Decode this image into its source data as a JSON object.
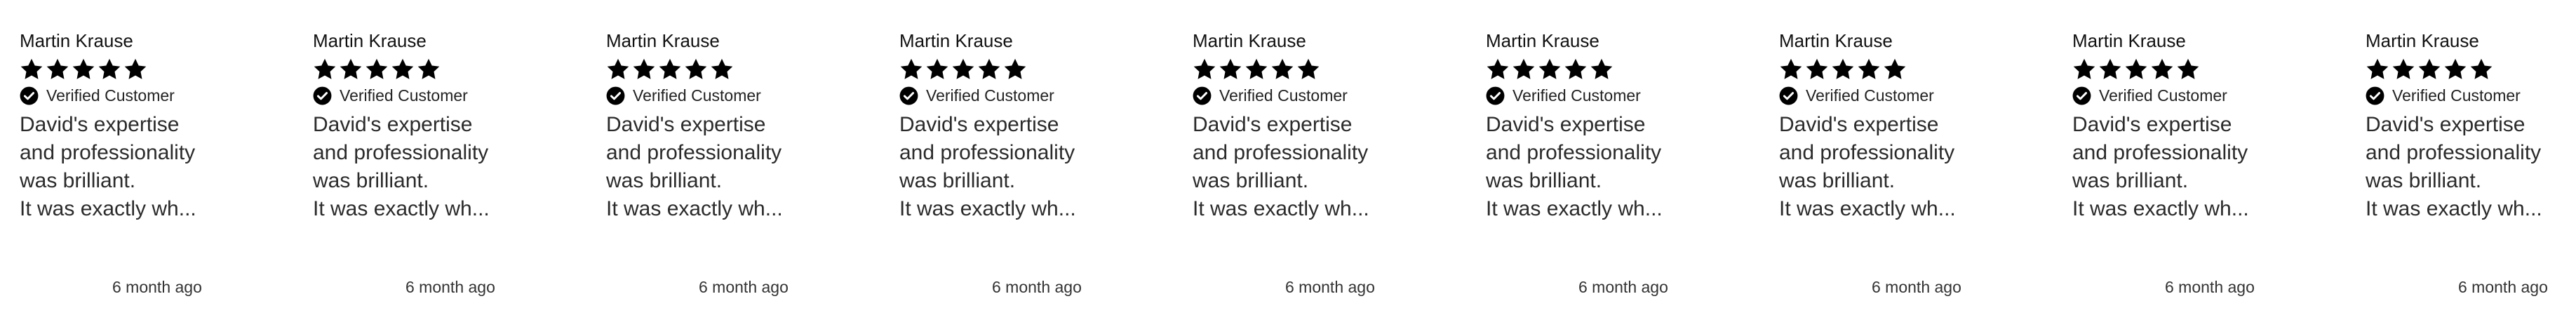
{
  "reviews": [
    {
      "name": "Martin Krause",
      "rating": 5,
      "verified_label": "Verified Customer",
      "text_lines": [
        "David's expertise",
        "and professionality",
        "was brilliant.",
        "It was exactly wh..."
      ],
      "date": "6 month ago"
    },
    {
      "name": "Martin Krause",
      "rating": 5,
      "verified_label": "Verified Customer",
      "text_lines": [
        "David's expertise",
        "and professionality",
        "was brilliant.",
        "It was exactly wh..."
      ],
      "date": "6 month ago"
    },
    {
      "name": "Martin Krause",
      "rating": 5,
      "verified_label": "Verified Customer",
      "text_lines": [
        "David's expertise",
        "and professionality",
        "was brilliant.",
        "It was exactly wh..."
      ],
      "date": "6 month ago"
    },
    {
      "name": "Martin Krause",
      "rating": 5,
      "verified_label": "Verified Customer",
      "text_lines": [
        "David's expertise",
        "and professionality",
        "was brilliant.",
        "It was exactly wh..."
      ],
      "date": "6 month ago"
    },
    {
      "name": "Martin Krause",
      "rating": 5,
      "verified_label": "Verified Customer",
      "text_lines": [
        "David's expertise",
        "and professionality",
        "was brilliant.",
        "It was exactly wh..."
      ],
      "date": "6 month ago"
    },
    {
      "name": "Martin Krause",
      "rating": 5,
      "verified_label": "Verified Customer",
      "text_lines": [
        "David's expertise",
        "and professionality",
        "was brilliant.",
        "It was exactly wh..."
      ],
      "date": "6 month ago"
    },
    {
      "name": "Martin Krause",
      "rating": 5,
      "verified_label": "Verified Customer",
      "text_lines": [
        "David's expertise",
        "and professionality",
        "was brilliant.",
        "It was exactly wh..."
      ],
      "date": "6 month ago"
    },
    {
      "name": "Martin Krause",
      "rating": 5,
      "verified_label": "Verified Customer",
      "text_lines": [
        "David's expertise",
        "and professionality",
        "was brilliant.",
        "It was exactly wh..."
      ],
      "date": "6 month ago"
    },
    {
      "name": "Martin Krause",
      "rating": 5,
      "verified_label": "Verified Customer",
      "text_lines": [
        "David's expertise",
        "and professionality",
        "was brilliant.",
        "It was exactly wh..."
      ],
      "date": "6 month ago"
    }
  ],
  "colors": {
    "star": "#000000",
    "verified_badge": "#000000",
    "text": "#2b2b2b",
    "background": "#ffffff"
  },
  "icons": {
    "star": "star-icon",
    "verified": "verified-check-icon"
  }
}
